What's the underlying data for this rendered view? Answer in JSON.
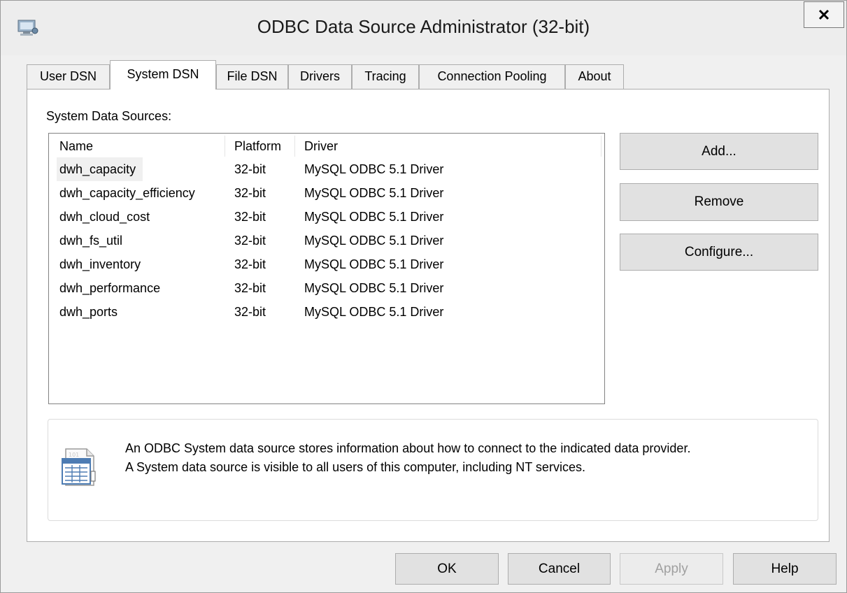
{
  "window": {
    "title": "ODBC Data Source Administrator (32-bit)",
    "close_label": "x"
  },
  "tabs": [
    {
      "label": "User DSN",
      "active": false
    },
    {
      "label": "System DSN",
      "active": true
    },
    {
      "label": "File DSN",
      "active": false
    },
    {
      "label": "Drivers",
      "active": false
    },
    {
      "label": "Tracing",
      "active": false
    },
    {
      "label": "Connection Pooling",
      "active": false
    },
    {
      "label": "About",
      "active": false
    }
  ],
  "system_dsn": {
    "section_label": "System Data Sources:",
    "columns": [
      "Name",
      "Platform",
      "Driver"
    ],
    "rows": [
      {
        "name": "dwh_capacity",
        "platform": "32-bit",
        "driver": "MySQL ODBC 5.1 Driver",
        "selected": true
      },
      {
        "name": "dwh_capacity_efficiency",
        "platform": "32-bit",
        "driver": "MySQL ODBC 5.1 Driver",
        "selected": false
      },
      {
        "name": "dwh_cloud_cost",
        "platform": "32-bit",
        "driver": "MySQL ODBC 5.1 Driver",
        "selected": false
      },
      {
        "name": "dwh_fs_util",
        "platform": "32-bit",
        "driver": "MySQL ODBC 5.1 Driver",
        "selected": false
      },
      {
        "name": "dwh_inventory",
        "platform": "32-bit",
        "driver": "MySQL ODBC 5.1 Driver",
        "selected": false
      },
      {
        "name": "dwh_performance",
        "platform": "32-bit",
        "driver": "MySQL ODBC 5.1 Driver",
        "selected": false
      },
      {
        "name": "dwh_ports",
        "platform": "32-bit",
        "driver": "MySQL ODBC 5.1 Driver",
        "selected": false
      }
    ],
    "buttons": {
      "add": "Add...",
      "remove": "Remove",
      "configure": "Configure..."
    },
    "info": {
      "line1": "An ODBC System data source stores information about how to connect to the indicated data provider.",
      "line2": "A System data source is visible to all users of this computer, including NT services."
    }
  },
  "footer": {
    "ok": "OK",
    "cancel": "Cancel",
    "apply": "Apply",
    "help": "Help"
  },
  "colors": {
    "window_bg": "#f0f0f0",
    "button_bg": "#e1e1e1",
    "disabled_text": "#a0a0a0"
  }
}
